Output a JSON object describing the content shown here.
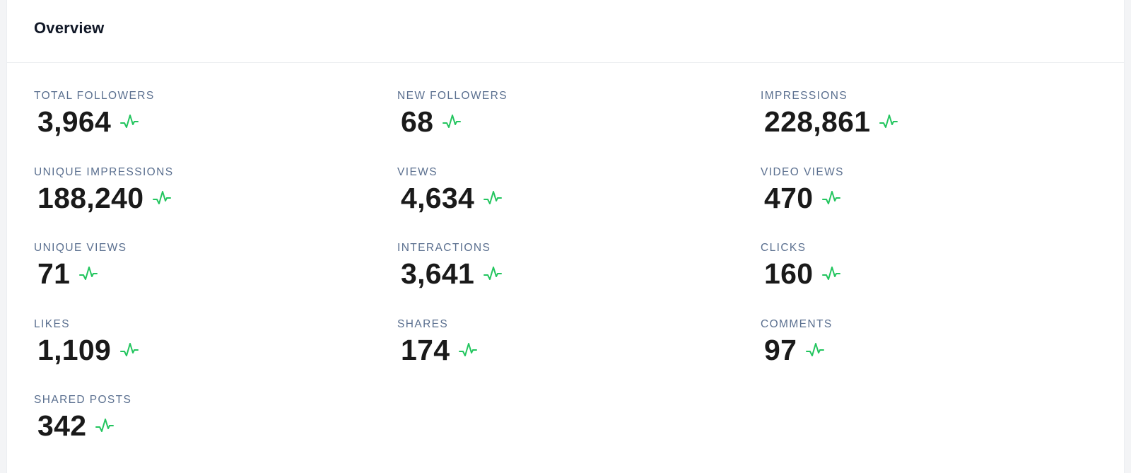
{
  "overview": {
    "title": "Overview",
    "accent_color": "#22c55e",
    "stats": [
      {
        "label": "TOTAL FOLLOWERS",
        "value": "3,964",
        "icon": "pulse-icon"
      },
      {
        "label": "NEW FOLLOWERS",
        "value": "68",
        "icon": "pulse-icon"
      },
      {
        "label": "IMPRESSIONS",
        "value": "228,861",
        "icon": "pulse-icon"
      },
      {
        "label": "UNIQUE IMPRESSIONS",
        "value": "188,240",
        "icon": "pulse-icon"
      },
      {
        "label": "VIEWS",
        "value": "4,634",
        "icon": "pulse-icon"
      },
      {
        "label": "VIDEO VIEWS",
        "value": "470",
        "icon": "pulse-icon"
      },
      {
        "label": "UNIQUE VIEWS",
        "value": "71",
        "icon": "pulse-icon"
      },
      {
        "label": "INTERACTIONS",
        "value": "3,641",
        "icon": "pulse-icon"
      },
      {
        "label": "CLICKS",
        "value": "160",
        "icon": "pulse-icon"
      },
      {
        "label": "LIKES",
        "value": "1,109",
        "icon": "pulse-icon"
      },
      {
        "label": "SHARES",
        "value": "174",
        "icon": "pulse-icon"
      },
      {
        "label": "COMMENTS",
        "value": "97",
        "icon": "pulse-icon"
      },
      {
        "label": "SHARED POSTS",
        "value": "342",
        "icon": "pulse-icon"
      }
    ]
  }
}
